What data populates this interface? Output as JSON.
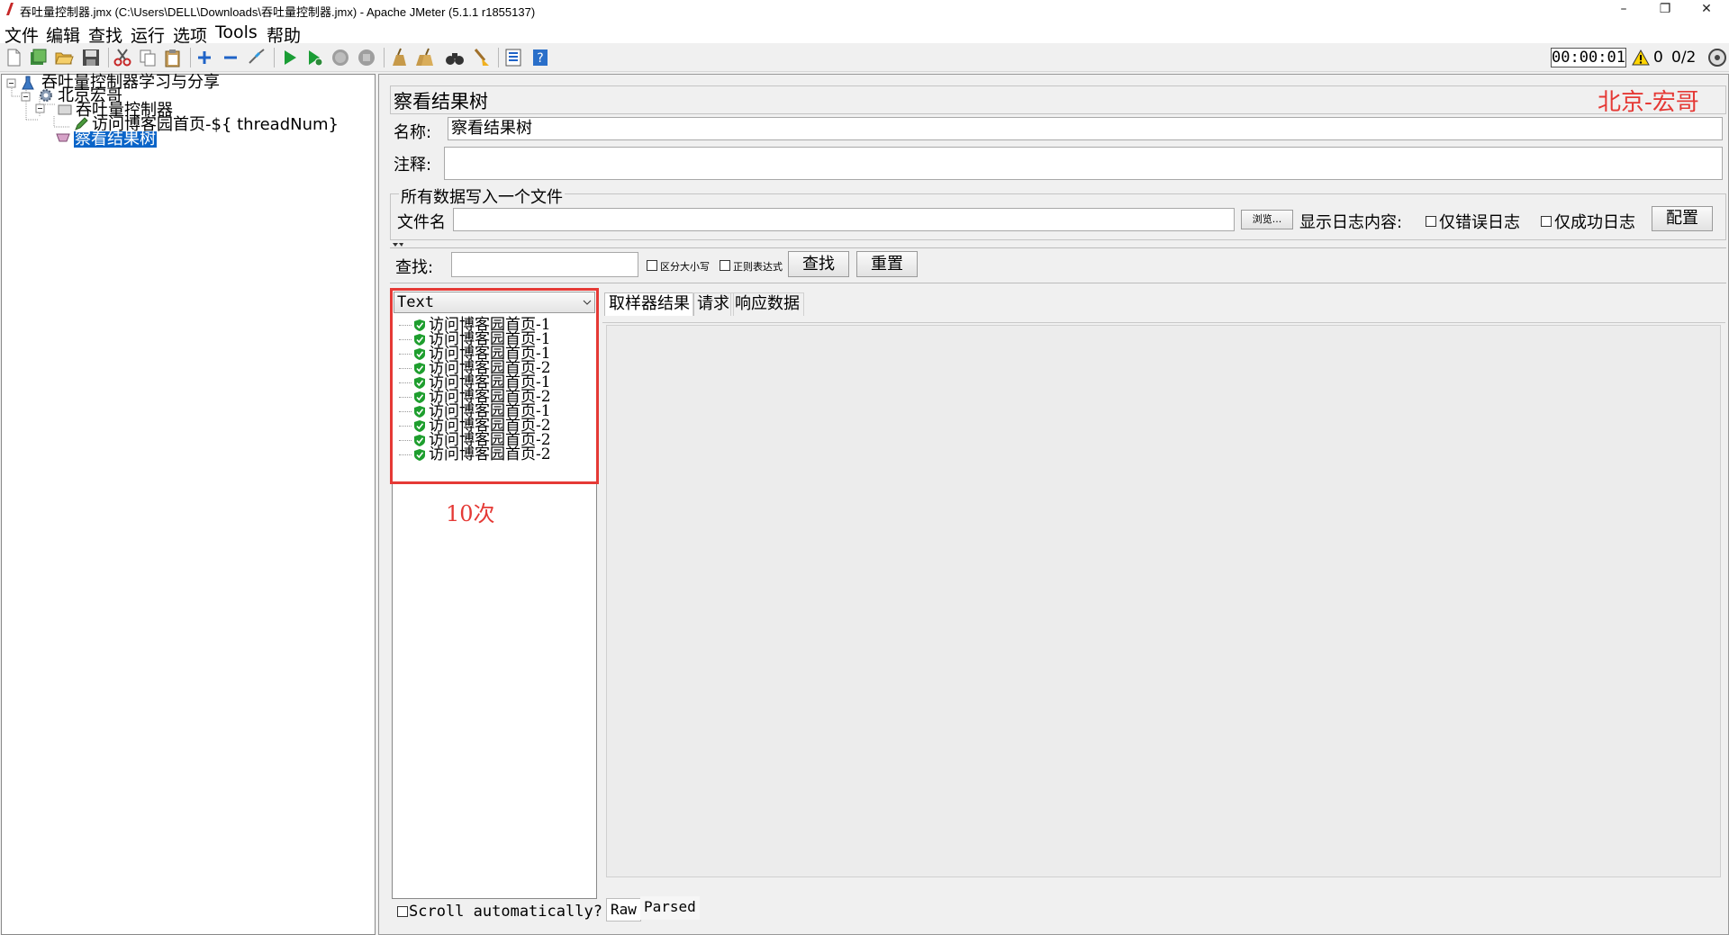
{
  "window": {
    "title": "吞吐量控制器.jmx (C:\\Users\\DELL\\Downloads\\吞吐量控制器.jmx) - Apache JMeter (5.1.1 r1855137)",
    "controls": [
      "–",
      "❐",
      "✕"
    ]
  },
  "menu": [
    "文件",
    "编辑",
    "查找",
    "运行",
    "选项",
    "Tools",
    "帮助"
  ],
  "toolbar": {
    "icons": [
      "new-icon",
      "templates-icon",
      "open-icon",
      "save-icon",
      "cut-icon",
      "copy-icon",
      "paste-icon",
      "expand-icon",
      "collapse-icon",
      "toggle-icon",
      "start-icon",
      "start-no-pause-icon",
      "stop-icon",
      "shutdown-icon",
      "clear-icon",
      "clear-all-icon",
      "search-icon",
      "reset-search-icon",
      "function-helper-icon",
      "help-icon"
    ],
    "timer": "00:00:01",
    "warning_count": "0",
    "threads": "0/2"
  },
  "tree": {
    "root": "吞吐量控制器学习与分享",
    "thread_group": "北京宏哥",
    "controller": "吞吐量控制器",
    "sampler": "访问博客园首页-${  threadNum}",
    "listener": "察看结果树"
  },
  "panel": {
    "title": "察看结果树",
    "watermark": "北京-宏哥",
    "name_label": "名称:",
    "name_value": "察看结果树",
    "comment_label": "注释:",
    "comment_value": "",
    "file_group": "所有数据写入一个文件",
    "filename_label": "文件名",
    "filename_value": "",
    "browse_btn": "浏览...",
    "log_label": "显示日志内容:",
    "errors_only": "仅错误日志",
    "success_only": "仅成功日志",
    "configure_btn": "配置",
    "search_label": "查找:",
    "search_value": "",
    "case_sensitive": "区分大小写",
    "regex": "正则表达式",
    "find_btn": "查找",
    "reset_btn": "重置",
    "renderer": "Text",
    "annotation": "10次",
    "scroll_auto": "Scroll automatically?",
    "tabs": [
      "取样器结果",
      "请求",
      "响应数据"
    ],
    "bottom_tabs": [
      "Raw",
      "Parsed"
    ]
  },
  "results": [
    "访问博客园首页-1",
    "访问博客园首页-1",
    "访问博客园首页-1",
    "访问博客园首页-2",
    "访问博客园首页-1",
    "访问博客园首页-2",
    "访问博客园首页-1",
    "访问博客园首页-2",
    "访问博客园首页-2",
    "访问博客园首页-2"
  ],
  "colors": {
    "accent_red": "#e53935",
    "selection": "#0a64c8",
    "success_green": "#1e9e2e"
  }
}
